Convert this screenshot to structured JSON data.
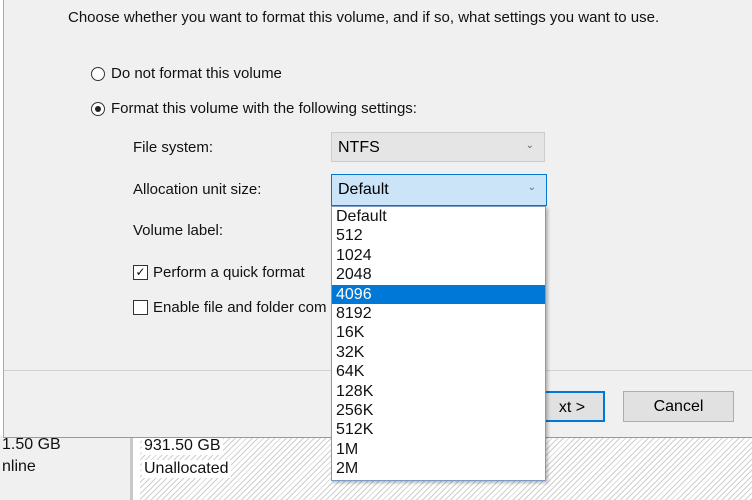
{
  "instruction": "Choose whether you want to format this volume, and if so, what settings you want to use.",
  "options": {
    "no_format": "Do not format this volume",
    "format": "Format this volume with the following settings:"
  },
  "file_system": {
    "label": "File system:",
    "value": "NTFS"
  },
  "allocation": {
    "label": "Allocation unit size:",
    "value": "Default",
    "options": [
      "Default",
      "512",
      "1024",
      "2048",
      "4096",
      "8192",
      "16K",
      "32K",
      "64K",
      "128K",
      "256K",
      "512K",
      "1M",
      "2M"
    ],
    "highlighted": "4096"
  },
  "volume_label": {
    "label": "Volume label:"
  },
  "quick_format": {
    "label": "Perform a quick format",
    "checked": true
  },
  "compression": {
    "label": "Enable file and folder com",
    "checked": false
  },
  "buttons": {
    "next": "xt >",
    "cancel": "Cancel"
  },
  "background": {
    "left_size": "1.50 GB",
    "left_status": "nline",
    "size": "931.50 GB",
    "status": "Unallocated"
  }
}
